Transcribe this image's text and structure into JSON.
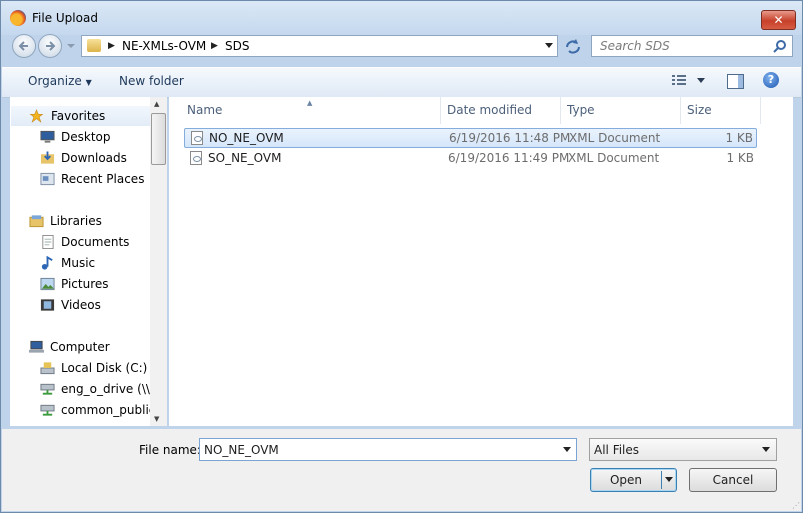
{
  "window": {
    "title": "File Upload",
    "close_glyph": "✕"
  },
  "address": {
    "crumbs": [
      "NE-XMLs-OVM",
      "SDS"
    ]
  },
  "search": {
    "placeholder": "Search SDS"
  },
  "toolbar": {
    "organize": "Organize",
    "new_folder": "New folder",
    "help": "?"
  },
  "nav": {
    "items": [
      {
        "label": "Favorites",
        "icon": "star-icon"
      },
      {
        "label": "Desktop",
        "icon": "desktop-icon"
      },
      {
        "label": "Downloads",
        "icon": "downloads-icon"
      },
      {
        "label": "Recent Places",
        "icon": "recent-places-icon"
      },
      {
        "label": "Libraries",
        "icon": "libraries-icon"
      },
      {
        "label": "Documents",
        "icon": "documents-icon"
      },
      {
        "label": "Music",
        "icon": "music-icon"
      },
      {
        "label": "Pictures",
        "icon": "pictures-icon"
      },
      {
        "label": "Videos",
        "icon": "videos-icon"
      },
      {
        "label": "Computer",
        "icon": "computer-icon"
      },
      {
        "label": "Local Disk (C:)",
        "icon": "disk-icon"
      },
      {
        "label": "eng_o_drive (\\\\ss",
        "icon": "network-drive-icon"
      },
      {
        "label": "common_public",
        "icon": "network-drive-icon"
      }
    ]
  },
  "columns": {
    "name": "Name",
    "date": "Date modified",
    "type": "Type",
    "size": "Size"
  },
  "files": [
    {
      "name": "NO_NE_OVM",
      "date": "6/19/2016 11:48 PM",
      "type": "XML Document",
      "size": "1 KB",
      "selected": true
    },
    {
      "name": "SO_NE_OVM",
      "date": "6/19/2016 11:49 PM",
      "type": "XML Document",
      "size": "1 KB",
      "selected": false
    }
  ],
  "bottom": {
    "file_name_label": "File name:",
    "file_name_value": "NO_NE_OVM",
    "filter_value": "All Files",
    "open_label": "Open",
    "cancel_label": "Cancel"
  },
  "colors": {
    "accent": "#1e395b",
    "selection": "#d5e6fa",
    "close": "#c7402a"
  }
}
